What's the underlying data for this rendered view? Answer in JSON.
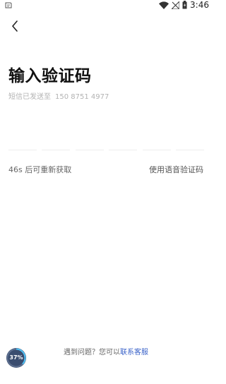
{
  "status_bar": {
    "time": "3:46",
    "left_icon": "notification-square-icon",
    "icons": [
      "wifi-icon",
      "no-signal-icon",
      "battery-icon"
    ]
  },
  "header": {
    "back_icon": "chevron-left-icon",
    "title": "输入验证码"
  },
  "sms_hint": {
    "prefix": "短信已发送至",
    "phone": "150 8751 4977"
  },
  "code_boxes": [
    "",
    "",
    "",
    "",
    "",
    ""
  ],
  "actions": {
    "countdown": "46s 后可重新获取",
    "voice_code": "使用语音验证码"
  },
  "help": {
    "question": "遇到问题？您可以",
    "contact": "联系客服"
  },
  "progress": {
    "label": "37%",
    "value": 0.37
  },
  "colors": {
    "accent": "#3b63c9",
    "progress_bg": "#3a4d6f",
    "progress_ring": "#4fc3f7"
  }
}
